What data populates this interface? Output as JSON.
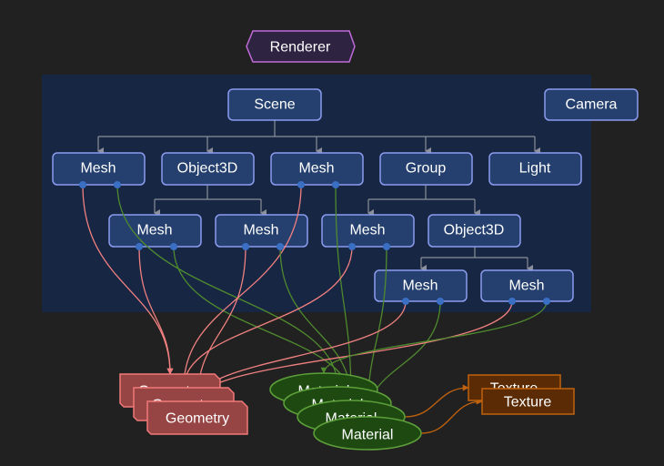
{
  "diagram": {
    "renderer": {
      "label": "Renderer"
    },
    "camera": {
      "label": "Camera"
    },
    "scene": {
      "label": "Scene"
    },
    "level1": [
      {
        "id": "mesh-a",
        "label": "Mesh"
      },
      {
        "id": "object3d-a",
        "label": "Object3D"
      },
      {
        "id": "mesh-b",
        "label": "Mesh"
      },
      {
        "id": "group",
        "label": "Group"
      },
      {
        "id": "light",
        "label": "Light"
      }
    ],
    "level2": [
      {
        "id": "mesh-c",
        "label": "Mesh",
        "parent": "object3d-a"
      },
      {
        "id": "mesh-d",
        "label": "Mesh",
        "parent": "object3d-a"
      },
      {
        "id": "mesh-e",
        "label": "Mesh",
        "parent": "group"
      },
      {
        "id": "object3d-b",
        "label": "Object3D",
        "parent": "group"
      }
    ],
    "level3": [
      {
        "id": "mesh-f",
        "label": "Mesh",
        "parent": "object3d-b"
      },
      {
        "id": "mesh-g",
        "label": "Mesh",
        "parent": "object3d-b"
      }
    ],
    "geometries": [
      {
        "label": "Geometry"
      },
      {
        "label": "Geometry"
      },
      {
        "label": "Geometry"
      }
    ],
    "materials": [
      {
        "label": "Material"
      },
      {
        "label": "Material"
      },
      {
        "label": "Material"
      },
      {
        "label": "Material"
      }
    ],
    "textures": [
      {
        "label": "Texture"
      },
      {
        "label": "Texture"
      }
    ],
    "mesh_links": [
      {
        "mesh": "mesh-a",
        "geometry": 0,
        "material": 1
      },
      {
        "mesh": "mesh-c",
        "geometry": 0,
        "material": 2
      },
      {
        "mesh": "mesh-b",
        "geometry": 1,
        "material": 2
      },
      {
        "mesh": "mesh-d",
        "geometry": 2,
        "material": 2
      },
      {
        "mesh": "mesh-e",
        "geometry": 1,
        "material": 3
      },
      {
        "mesh": "mesh-f",
        "geometry": 2,
        "material": 3
      },
      {
        "mesh": "mesh-g",
        "geometry": 2,
        "material": 0
      }
    ],
    "texture_links": [
      {
        "material": 2,
        "texture": 0
      },
      {
        "material": 3,
        "texture": 1
      }
    ],
    "colors": {
      "background": "#212121",
      "panel": "#172643",
      "node_fill": "#25406e",
      "node_stroke": "#8c9cf0",
      "renderer_stroke": "#c06ad8",
      "geometry_fill": "#964444",
      "material_fill": "#1e4a12",
      "texture_fill": "#5a2b05"
    }
  }
}
